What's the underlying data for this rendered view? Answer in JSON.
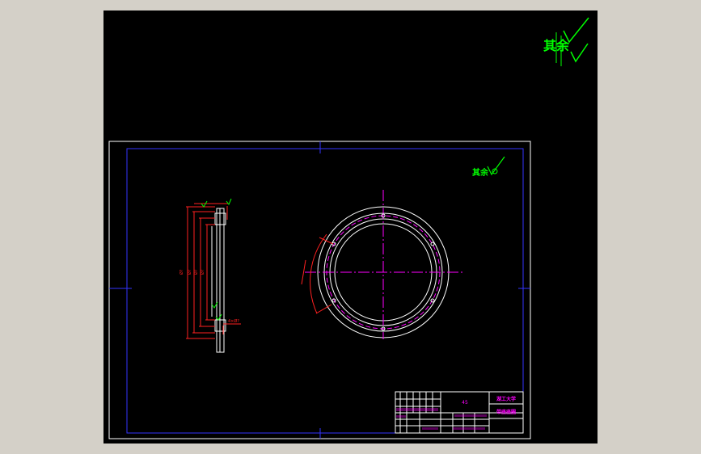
{
  "colors": {
    "background": "#d4d0c8",
    "viewport": "#000000",
    "sheet_border": "#ffffff",
    "frame": "#3434ff",
    "geometry": "#ffffff",
    "dimension": "#ff2020",
    "centerline": "#ff00ff",
    "text_green": "#00ff00",
    "title_text": "#ff00ff"
  },
  "surface_note": {
    "top_symbol_text": "其余",
    "top_symbol_icon": "surface-finish-check-icon",
    "sheet_symbol_text": "其余",
    "sheet_symbol_icon": "surface-finish-check-icon"
  },
  "section_view": {
    "dimensions": [
      "Ø?",
      "Ø?",
      "Ø?",
      "Ø?"
    ],
    "note_right": "4×Ø?"
  },
  "title_block": {
    "material": "45",
    "school": "湖工大学",
    "part_name": "带座座圈"
  }
}
